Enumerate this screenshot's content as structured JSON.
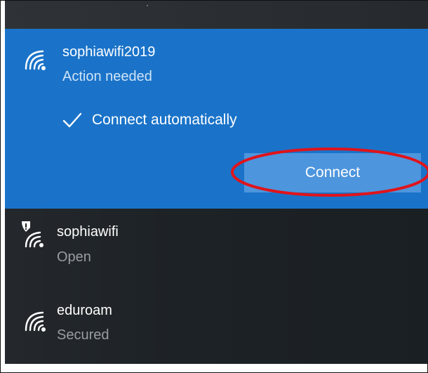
{
  "networks": [
    {
      "name": "sophiawifi2019",
      "status": "Action needed",
      "icon": "wifi-signal-icon",
      "selected": true,
      "connect_automatically": {
        "label": "Connect automatically",
        "checked": true
      },
      "connect_button": "Connect"
    },
    {
      "name": "sophiawifi",
      "status": "Open",
      "icon": "wifi-signal-warning-icon",
      "selected": false
    },
    {
      "name": "eduroam",
      "status": "Secured",
      "icon": "wifi-signal-icon",
      "selected": false
    }
  ],
  "colors": {
    "accent": "#1a73c9",
    "button": "#4d95dd",
    "panel_background": "#1d2226",
    "highlight_ring": "#e0141b",
    "status_on_accent": "#cfe3f6",
    "status_on_dark": "#9a9da0"
  }
}
